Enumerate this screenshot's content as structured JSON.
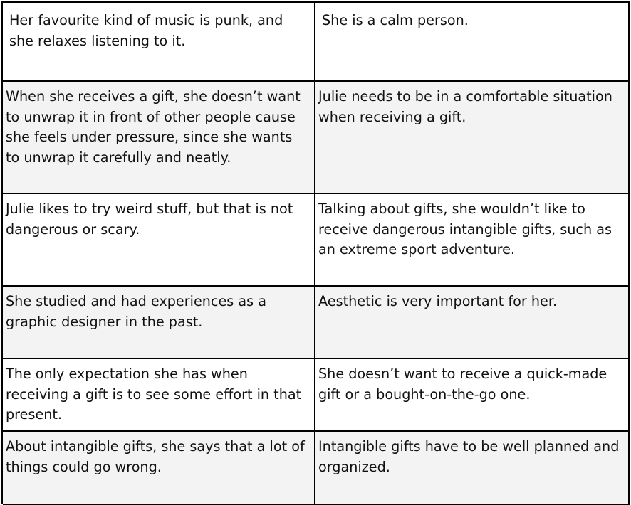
{
  "table": {
    "rows": [
      {
        "left": "Her favourite kind of music is punk, and she relaxes listening to it.",
        "right": "She is a calm person."
      },
      {
        "left": "When she receives a gift, she doesn’t want to unwrap it in front of other people cause she feels under pressure, since she wants to unwrap it carefully and neatly.",
        "right": "Julie needs to be in a comfortable situation when receiving a gift."
      },
      {
        "left": "Julie likes to try weird stuff, but that is not dangerous or scary.",
        "right": "Talking about gifts, she wouldn’t like to receive dangerous intangible gifts, such as an extreme sport adventure."
      },
      {
        "left": "She studied and had experiences as a graphic designer in the past.",
        "right": "Aesthetic is very important for her."
      },
      {
        "left": "The only expectation she has when receiving a gift is to see some effort in that present.",
        "right": "She doesn’t want to receive a quick-made gift or a bought-on-the-go one."
      },
      {
        "left": "About intangible gifts, she says that a lot of things could go wrong.",
        "right": "Intangible gifts have to be well planned and organized."
      }
    ]
  }
}
